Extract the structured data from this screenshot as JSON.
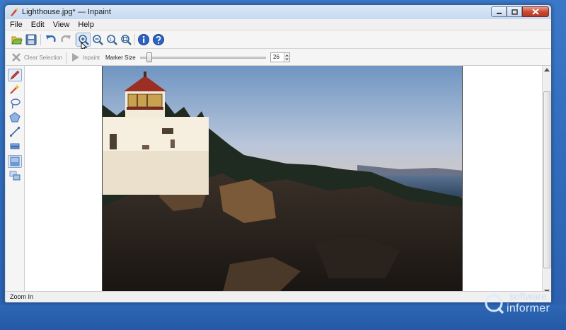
{
  "window": {
    "title": "Lighthouse.jpg* — Inpaint"
  },
  "menu": {
    "items": [
      "File",
      "Edit",
      "View",
      "Help"
    ]
  },
  "toolbar": {
    "buttons": [
      "open-icon",
      "save-icon",
      "undo-icon",
      "redo-icon",
      "zoom-in-icon",
      "zoom-out-icon",
      "zoom-actual-icon",
      "zoom-fit-icon",
      "info-icon",
      "help-icon"
    ]
  },
  "toolbar2": {
    "clear_selection": "Clear Selection",
    "inpaint": "Inpaint",
    "marker_size_label": "Marker Size",
    "marker_size_value": "26",
    "marker_size_level": 0.05
  },
  "tools": [
    "marker-icon",
    "magic-wand-icon",
    "lasso-icon",
    "polygon-icon",
    "line-icon",
    "eraser-icon",
    "rect-select-icon",
    "multi-select-icon"
  ],
  "canvas": {
    "image_name": "Lighthouse.jpg"
  },
  "status": {
    "text": "Zoom In"
  },
  "watermark": {
    "line1": "software",
    "line2": "informer"
  }
}
